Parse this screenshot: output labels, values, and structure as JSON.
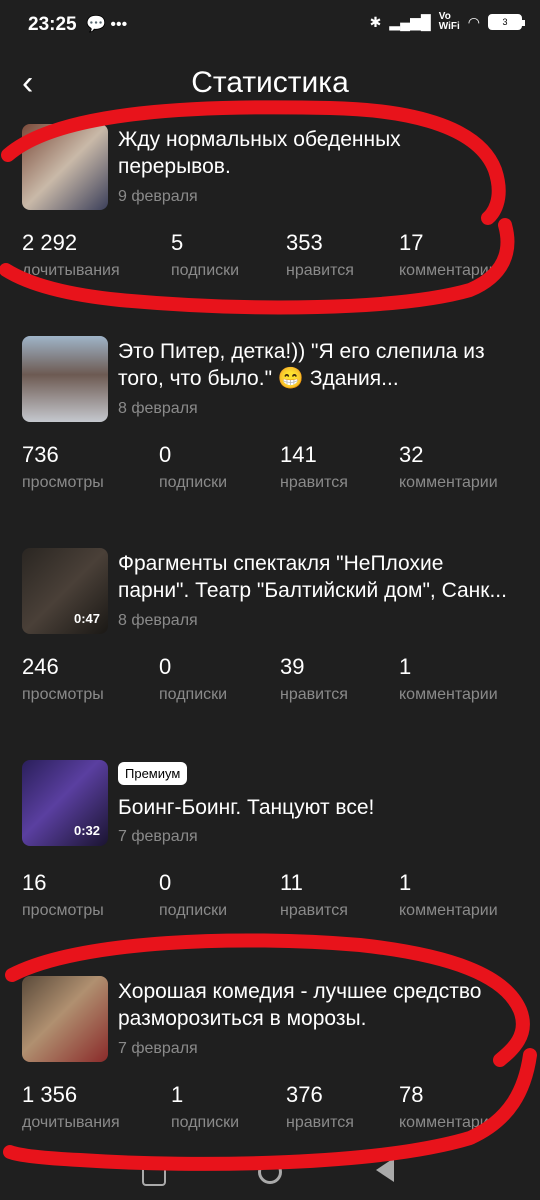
{
  "status_bar": {
    "time": "23:25",
    "battery": "3"
  },
  "header": {
    "back_icon": "‹",
    "title": "Статистика"
  },
  "posts": [
    {
      "title": "Жду нормальных обеденных перерывов.",
      "date": "9 февраля",
      "stats": [
        {
          "value": "2 292",
          "label": "дочитывания"
        },
        {
          "value": "5",
          "label": "подписки"
        },
        {
          "value": "353",
          "label": "нравится"
        },
        {
          "value": "17",
          "label": "комментарии"
        }
      ]
    },
    {
      "title": "Это Питер, детка!)) \"Я его слепила из того, что было.\" 😁 Здания...",
      "date": "8 февраля",
      "stats": [
        {
          "value": "736",
          "label": "просмотры"
        },
        {
          "value": "0",
          "label": "подписки"
        },
        {
          "value": "141",
          "label": "нравится"
        },
        {
          "value": "32",
          "label": "комментарии"
        }
      ]
    },
    {
      "title": "Фрагменты спектакля \"НеПлохие парни\". Театр \"Балтийский дом\", Санк...",
      "date": "8 февраля",
      "duration": "0:47",
      "stats": [
        {
          "value": "246",
          "label": "просмотры"
        },
        {
          "value": "0",
          "label": "подписки"
        },
        {
          "value": "39",
          "label": "нравится"
        },
        {
          "value": "1",
          "label": "комментарии"
        }
      ]
    },
    {
      "badge": "Премиум",
      "title": "Боинг-Боинг. Танцуют все!",
      "date": "7 февраля",
      "duration": "0:32",
      "stats": [
        {
          "value": "16",
          "label": "просмотры"
        },
        {
          "value": "0",
          "label": "подписки"
        },
        {
          "value": "11",
          "label": "нравится"
        },
        {
          "value": "1",
          "label": "комментарии"
        }
      ]
    },
    {
      "title": "Хорошая комедия - лучшее средство разморозиться в морозы.",
      "date": "7 февраля",
      "stats": [
        {
          "value": "1 356",
          "label": "дочитывания"
        },
        {
          "value": "1",
          "label": "подписки"
        },
        {
          "value": "376",
          "label": "нравится"
        },
        {
          "value": "78",
          "label": "комментарии"
        }
      ]
    }
  ],
  "colors": {
    "background": "#1f1f1f",
    "secondary_text": "#8a8a8a",
    "annotation": "#e8131b"
  }
}
